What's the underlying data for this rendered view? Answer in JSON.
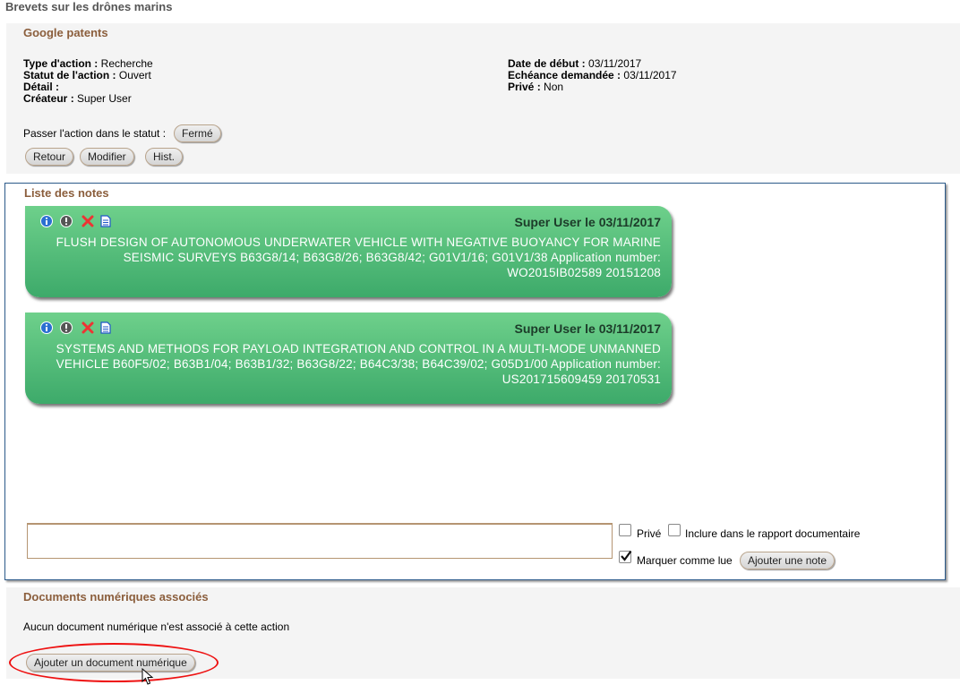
{
  "page": {
    "title": "Brevets sur les drônes marins"
  },
  "action": {
    "section_title": "Google patents",
    "type_label": "Type d'action :",
    "type_value": "Recherche",
    "status_label": "Statut de l'action :",
    "status_value": "Ouvert",
    "detail_label": "Détail :",
    "detail_value": "",
    "creator_label": "Créateur :",
    "creator_value": "Super User",
    "start_label": "Date de début :",
    "start_value": "03/11/2017",
    "due_label": "Echéance demandée :",
    "due_value": "03/11/2017",
    "private_label": "Privé :",
    "private_value": "Non",
    "change_status_label": "Passer l'action dans le statut :",
    "change_status_button": "Fermé",
    "buttons": {
      "back": "Retour",
      "edit": "Modifier",
      "history": "Hist."
    }
  },
  "notes": {
    "section_title": "Liste des notes",
    "items": [
      {
        "author": "Super User le 03/11/2017",
        "text": "FLUSH DESIGN OF AUTONOMOUS UNDERWATER VEHICLE WITH NEGATIVE BUOYANCY FOR MARINE SEISMIC SURVEYS B63G8/14; B63G8/26; B63G8/42; G01V1/16; G01V1/38 Application number: WO2015IB02589 20151208"
      },
      {
        "author": "Super User le 03/11/2017",
        "text": "SYSTEMS AND METHODS FOR PAYLOAD INTEGRATION AND CONTROL IN A MULTI-MODE UNMANNED VEHICLE B60F5/02; B63B1/04; B63B1/32; B63G8/22; B64C3/38; B64C39/02; G05D1/00 Application number: US201715609459 20170531"
      }
    ],
    "form": {
      "textarea_value": "",
      "private_label": "Privé",
      "private_checked": false,
      "include_label": "Inclure dans le rapport documentaire",
      "include_checked": false,
      "mark_read_label": "Marquer comme lue",
      "mark_read_checked": true,
      "add_button": "Ajouter une note"
    }
  },
  "documents": {
    "section_title": "Documents numériques associés",
    "empty_text": "Aucun document numérique n'est associé à cette action",
    "add_button": "Ajouter un document numérique"
  }
}
